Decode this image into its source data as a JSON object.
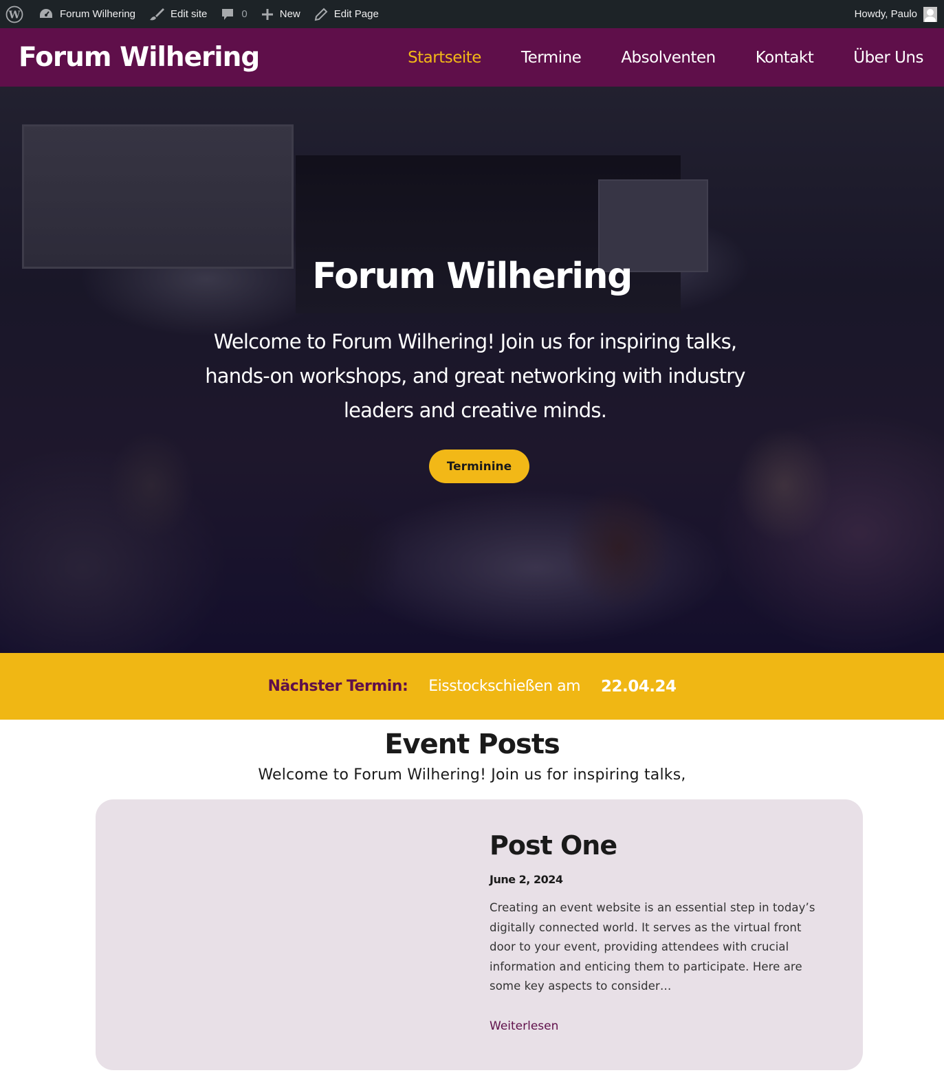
{
  "adminbar": {
    "wp_logo_icon": "wordpress-icon",
    "site_name": "Forum Wilhering",
    "edit_site": "Edit site",
    "comments_count": "0",
    "new_label": "New",
    "edit_page": "Edit Page",
    "howdy": "Howdy, Paulo"
  },
  "header": {
    "site_title": "Forum Wilhering",
    "nav": [
      {
        "label": "Startseite",
        "active": true
      },
      {
        "label": "Termine"
      },
      {
        "label": "Absolventen"
      },
      {
        "label": "Kontakt"
      },
      {
        "label": "Über Uns"
      }
    ],
    "bg_color": "#5f0f4a",
    "accent_color": "#f2b817"
  },
  "hero": {
    "title": "Forum Wilhering",
    "text": "Welcome to Forum Wilhering! Join us for inspiring talks, hands-on workshops, and great networking with industry leaders and creative minds.",
    "button": "Terminine"
  },
  "next_event": {
    "label": "Nächster Termin:",
    "event": "Eisstockschießen am",
    "date": "22.04.24",
    "bg_color": "#f0b714"
  },
  "posts": {
    "heading": "Event Posts",
    "subheading": "Welcome to Forum Wilhering! Join us for inspiring talks,",
    "items": [
      {
        "title": "Post One",
        "date": "June 2, 2024",
        "excerpt": "Creating an event website is an essential step in today’s digitally connected world. It serves as the virtual front door to your event, providing attendees with crucial information and enticing them to participate. Here are some key aspects to consider…",
        "read_more": "Weiterlesen"
      }
    ]
  }
}
